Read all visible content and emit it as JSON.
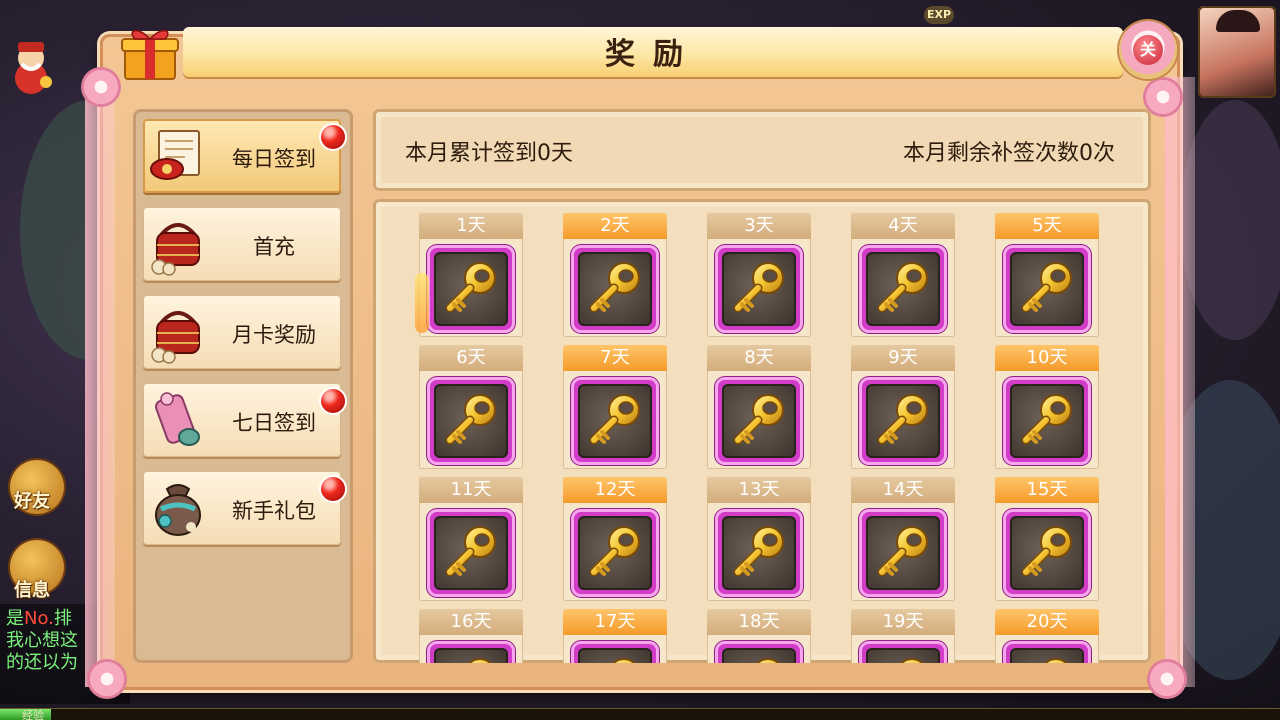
{
  "dialog": {
    "title": "奖励",
    "close_label": "关"
  },
  "menu": {
    "items": [
      {
        "label": "每日签到",
        "active": true,
        "badge": true,
        "icon": "scroll-envelope-icon"
      },
      {
        "label": "首充",
        "active": false,
        "badge": false,
        "icon": "food-basket-icon"
      },
      {
        "label": "月卡奖励",
        "active": false,
        "badge": false,
        "icon": "food-basket-icon"
      },
      {
        "label": "七日签到",
        "active": false,
        "badge": true,
        "icon": "scroll-roll-icon"
      },
      {
        "label": "新手礼包",
        "active": false,
        "badge": true,
        "icon": "treasure-bag-icon"
      }
    ]
  },
  "info": {
    "checkin_count": "本月累计签到0天",
    "makeup_count": "本月剩余补签次数0次"
  },
  "days": [
    {
      "label": "1天",
      "style": "tan",
      "reward_icon": "golden-key-icon"
    },
    {
      "label": "2天",
      "style": "orange",
      "reward_icon": "golden-key-icon"
    },
    {
      "label": "3天",
      "style": "tan",
      "reward_icon": "golden-key-icon"
    },
    {
      "label": "4天",
      "style": "tan",
      "reward_icon": "golden-key-icon"
    },
    {
      "label": "5天",
      "style": "orange",
      "reward_icon": "golden-key-icon"
    },
    {
      "label": "6天",
      "style": "tan",
      "reward_icon": "golden-key-icon"
    },
    {
      "label": "7天",
      "style": "orange",
      "reward_icon": "golden-key-icon"
    },
    {
      "label": "8天",
      "style": "tan",
      "reward_icon": "golden-key-icon"
    },
    {
      "label": "9天",
      "style": "tan",
      "reward_icon": "golden-key-icon"
    },
    {
      "label": "10天",
      "style": "orange",
      "reward_icon": "golden-key-icon"
    },
    {
      "label": "11天",
      "style": "tan",
      "reward_icon": "golden-key-icon"
    },
    {
      "label": "12天",
      "style": "orange",
      "reward_icon": "golden-key-icon"
    },
    {
      "label": "13天",
      "style": "tan",
      "reward_icon": "golden-key-icon"
    },
    {
      "label": "14天",
      "style": "tan",
      "reward_icon": "golden-key-icon"
    },
    {
      "label": "15天",
      "style": "orange",
      "reward_icon": "golden-key-icon"
    },
    {
      "label": "16天",
      "style": "tan",
      "reward_icon": "golden-key-icon"
    },
    {
      "label": "17天",
      "style": "orange",
      "reward_icon": "golden-key-icon"
    },
    {
      "label": "18天",
      "style": "tan",
      "reward_icon": "golden-key-icon"
    },
    {
      "label": "19天",
      "style": "tan",
      "reward_icon": "golden-key-icon"
    },
    {
      "label": "20天",
      "style": "orange",
      "reward_icon": "golden-key-icon"
    }
  ],
  "hud": {
    "friends_label": "好友",
    "messages_label": "信息",
    "exp_tag": "EXP",
    "exp_label": "经验",
    "exp_progress": 0.04,
    "chat_lines": [
      {
        "prefix": "是",
        "rank": "No.",
        "suffix": "排"
      },
      {
        "prefix": "我心想这",
        "rank": "",
        "suffix": ""
      },
      {
        "prefix": "的还以为",
        "rank": "",
        "suffix": ""
      }
    ]
  },
  "colors": {
    "dialog_bg": "#eab37d",
    "tab_active": "#f2c878",
    "day_orange": "#f59a2a",
    "day_tan": "#d3ad7c",
    "slot_magenta": "#d23cc8",
    "badge_red": "#f02a20"
  }
}
